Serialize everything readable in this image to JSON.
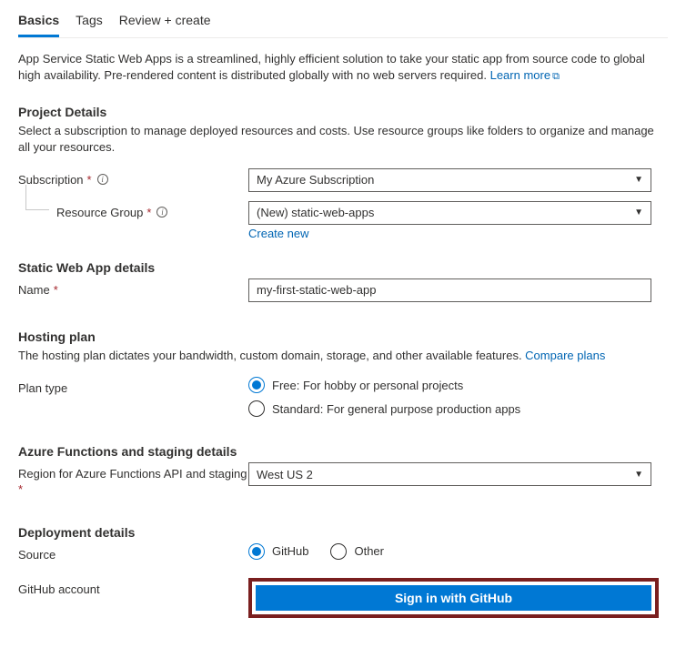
{
  "tabs": {
    "basics": "Basics",
    "tags": "Tags",
    "review": "Review + create"
  },
  "intro": {
    "text": "App Service Static Web Apps is a streamlined, highly efficient solution to take your static app from source code to global high availability. Pre-rendered content is distributed globally with no web servers required.  ",
    "learn_more": "Learn more"
  },
  "project": {
    "title": "Project Details",
    "desc": "Select a subscription to manage deployed resources and costs. Use resource groups like folders to organize and manage all your resources.",
    "subscription_label": "Subscription",
    "subscription_value": "My Azure Subscription",
    "resource_group_label": "Resource Group",
    "resource_group_value": "(New) static-web-apps",
    "create_new": "Create new"
  },
  "details": {
    "title": "Static Web App details",
    "name_label": "Name",
    "name_value": "my-first-static-web-app"
  },
  "hosting": {
    "title": "Hosting plan",
    "desc": "The hosting plan dictates your bandwidth, custom domain, storage, and other available features. ",
    "compare": "Compare plans",
    "plan_type_label": "Plan type",
    "free_label": "Free: For hobby or personal projects",
    "standard_label": "Standard: For general purpose production apps"
  },
  "functions": {
    "title": "Azure Functions and staging details",
    "region_label": "Region for Azure Functions API and staging",
    "region_value": "West US 2"
  },
  "deployment": {
    "title": "Deployment details",
    "source_label": "Source",
    "github_label": "GitHub",
    "other_label": "Other",
    "account_label": "GitHub account",
    "signin_button": "Sign in with GitHub"
  }
}
